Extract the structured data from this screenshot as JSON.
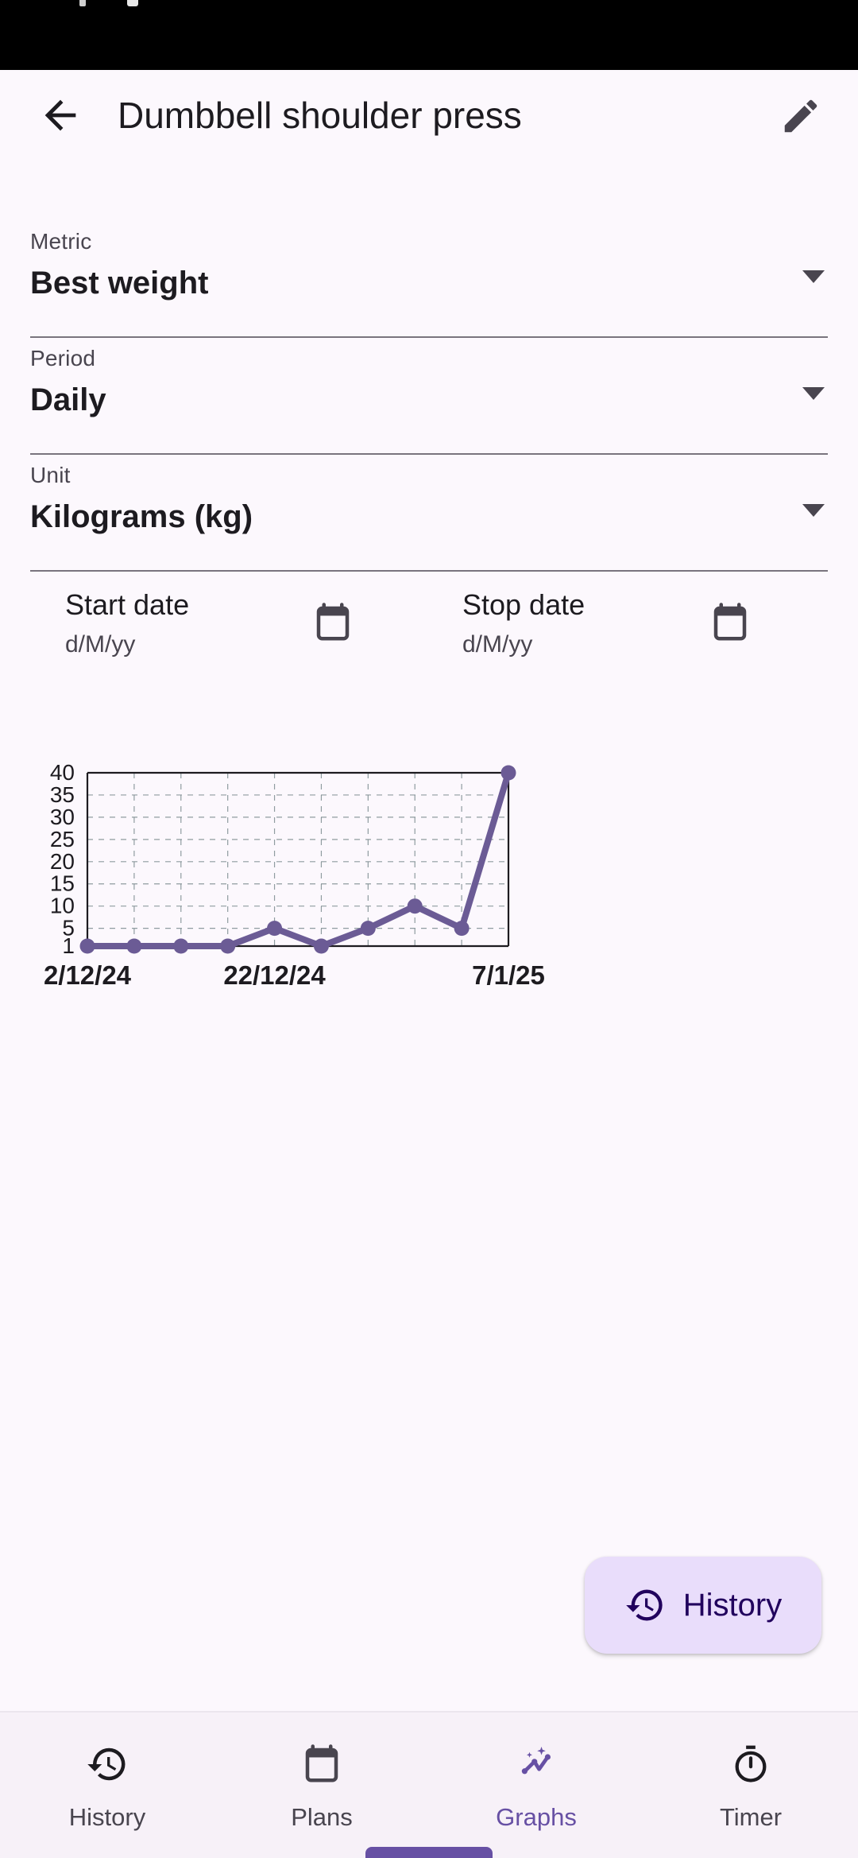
{
  "statusbar": {
    "background": "#000000"
  },
  "appbar": {
    "back_icon": "arrow-left-icon",
    "title": "Dumbbell shoulder press",
    "edit_icon": "pencil-edit-icon"
  },
  "fields": [
    {
      "label": "Metric",
      "value": "Best weight",
      "icon": "chevron-down-icon"
    },
    {
      "label": "Period",
      "value": "Daily",
      "icon": "chevron-down-icon"
    },
    {
      "label": "Unit",
      "value": "Kilograms (kg)",
      "icon": "chevron-down-icon"
    }
  ],
  "dates": [
    {
      "title": "Start date",
      "hint": "d/M/yy",
      "icon": "calendar-icon"
    },
    {
      "title": "Stop date",
      "hint": "d/M/yy",
      "icon": "calendar-icon"
    }
  ],
  "fab": {
    "label": "History",
    "icon": "history-clock-icon",
    "background": "#E9DDFB",
    "text_color": "#21005D"
  },
  "bottom_nav": {
    "active_color": "#6750A4",
    "inactive_color": "#49454F",
    "items": [
      {
        "label": "History",
        "icon": "history-clock-icon",
        "active": false
      },
      {
        "label": "Plans",
        "icon": "calendar-icon",
        "active": false
      },
      {
        "label": "Graphs",
        "icon": "query-stats-icon",
        "active": true
      },
      {
        "label": "Timer",
        "icon": "stopwatch-icon",
        "active": false
      }
    ]
  },
  "chart_data": {
    "type": "line",
    "title": "",
    "xlabel": "",
    "ylabel": "",
    "x": [
      "2/12/24",
      "",
      "",
      "",
      "",
      "",
      "22/12/24",
      "",
      "",
      "7/1/25"
    ],
    "tick_labels": [
      "2/12/24",
      "22/12/24",
      "7/1/25"
    ],
    "values": [
      1,
      1,
      1,
      1,
      5,
      1,
      5,
      10,
      5,
      40
    ],
    "yticks": [
      1,
      5,
      10,
      15,
      20,
      25,
      30,
      35,
      40
    ],
    "ylim": [
      1,
      40
    ],
    "grid": true,
    "legend": "none",
    "line_color": "#6B5B95",
    "marker_color": "#6B5B95",
    "marker": "circle",
    "unit": "kg"
  }
}
